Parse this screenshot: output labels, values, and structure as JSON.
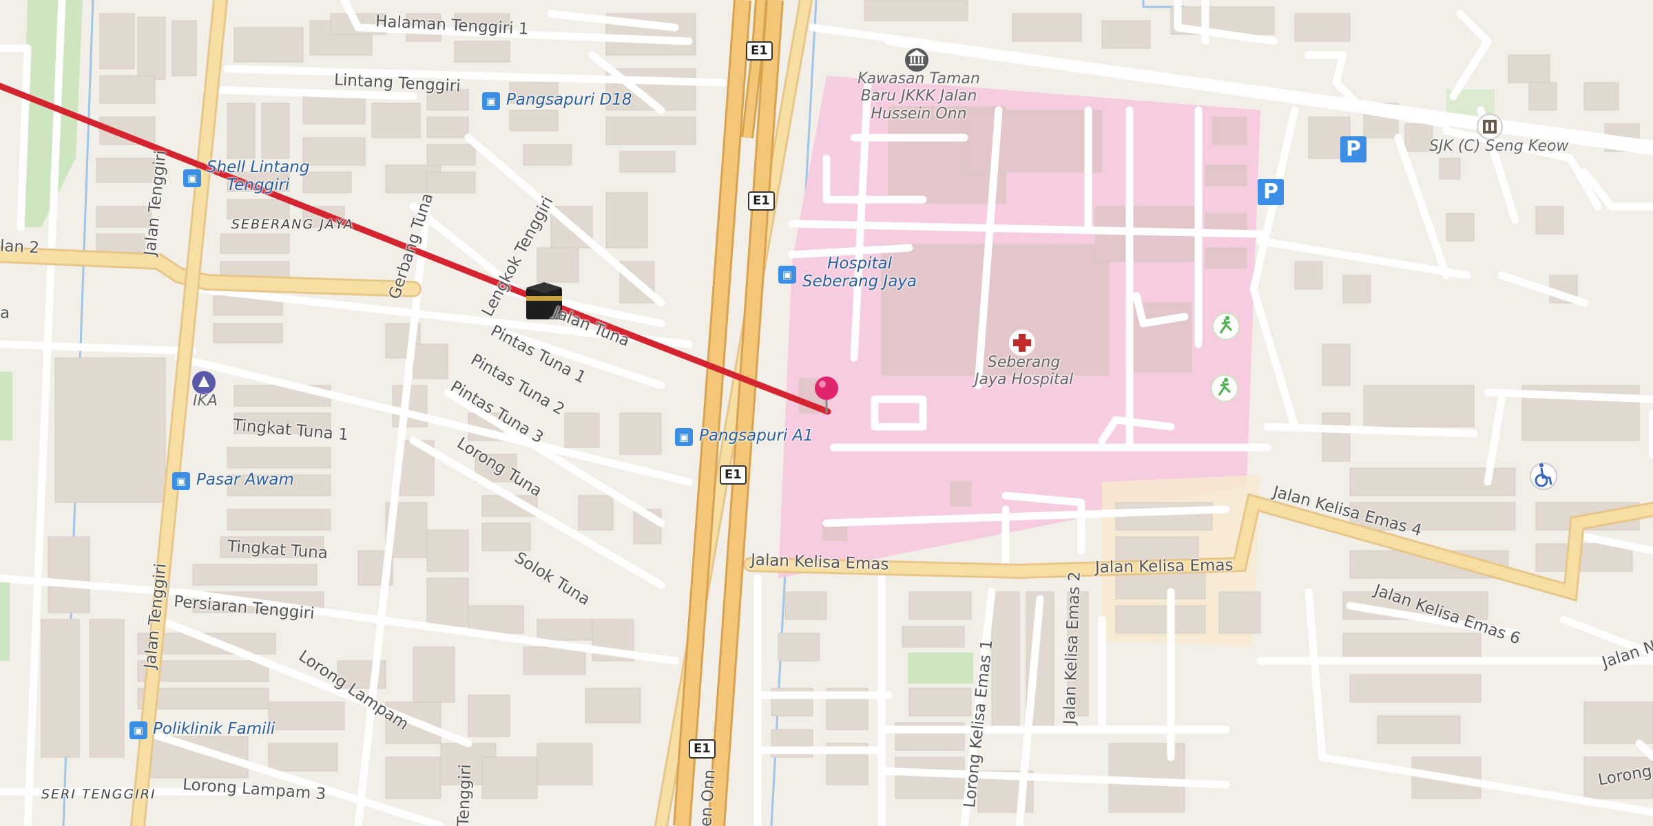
{
  "map": {
    "streets": {
      "halaman_tenggiri_1": "Halaman Tenggiri 1",
      "lintang_tenggiri": "Lintang Tenggiri",
      "jalan_tenggiri_a": "Jalan Tenggiri",
      "jalan_tenggiri_b": "Jalan Tenggiri",
      "gerbang_tuna": "Gerbang Tuna",
      "lengkok_tenggiri": "Lengkok Tenggiri",
      "jalan_tuna": "Jalan Tuna",
      "pintas_tuna_1": "Pintas Tuna 1",
      "pintas_tuna_2": "Pintas Tuna 2",
      "pintas_tuna_3": "Pintas Tuna 3",
      "lorong_tuna": "Lorong Tuna",
      "solok_tuna": "Solok Tuna",
      "tingkat_tuna_1": "Tingkat Tuna 1",
      "tingkat_tuna": "Tingkat Tuna",
      "persiaran_tenggiri": "Persiaran Tenggiri",
      "lorong_lampam": "Lorong Lampam",
      "lorong_lampam_3": "Lorong Lampam 3",
      "tenggiri_partial": "Tenggiri",
      "jalan_kelisa_emas_a": "Jalan Kelisa Emas",
      "jalan_kelisa_emas_b": "Jalan Kelisa Emas",
      "jalan_kelisa_emas_1": "Lorong Kelisa Emas 1",
      "jalan_kelisa_emas_2": "Jalan Kelisa Emas 2",
      "jalan_kelisa_emas_4": "Jalan Kelisa Emas 4",
      "jalan_kelisa_emas_6": "Jalan Kelisa Emas 6",
      "jalan_n_partial": "Jalan N",
      "lorong_partial": "Lorong",
      "hussein_onn_partial": "en Onn",
      "jalan_2_partial": "lan 2",
      "a_partial": "a"
    },
    "areas": {
      "seberang_jaya": "SEBERANG JAYA",
      "seri_tenggiri": "SERI TENGGIRI"
    },
    "pois": {
      "pangsapuri_d18": "Pangsapuri D18",
      "shell_lintang": "Shell Lintang\nTenggiri",
      "ika": "IKA",
      "pasar_awam": "Pasar Awam",
      "poliklinik_famili": "Poliklinik Famili",
      "hospital_sj": "Hospital\nSeberang Jaya",
      "pangsapuri_a1": "Pangsapuri A1",
      "kawasan_taman": "Kawasan Taman\nBaru JKKK Jalan\nHussein Onn",
      "seberang_jaya_hospital": "Seberang\nJaya Hospital",
      "sjk_seng_keow": "SJK (C) Seng Keow"
    },
    "highway_shields": [
      "E1",
      "E1",
      "E1",
      "E1"
    ],
    "icons": {
      "parking": "P",
      "bus": "bus-stop-icon",
      "hospital": "hospital-cross-icon",
      "kaaba": "kaaba-icon",
      "pin": "location-pin-icon",
      "museum": "museum-icon",
      "school": "school-icon",
      "emergency_exit": "emergency-exit-icon",
      "wheelchair": "wheelchair-icon"
    },
    "colors": {
      "background": "#f2efe9",
      "building": "#e1d8cf",
      "hospital_area": "#f7cbe0",
      "motorway": "#f3c777",
      "primary_road": "#f7dfa4",
      "route_line": "#d42430",
      "park": "#cde6bf",
      "water": "#9ec6ea",
      "pin": "#e0256e"
    }
  }
}
